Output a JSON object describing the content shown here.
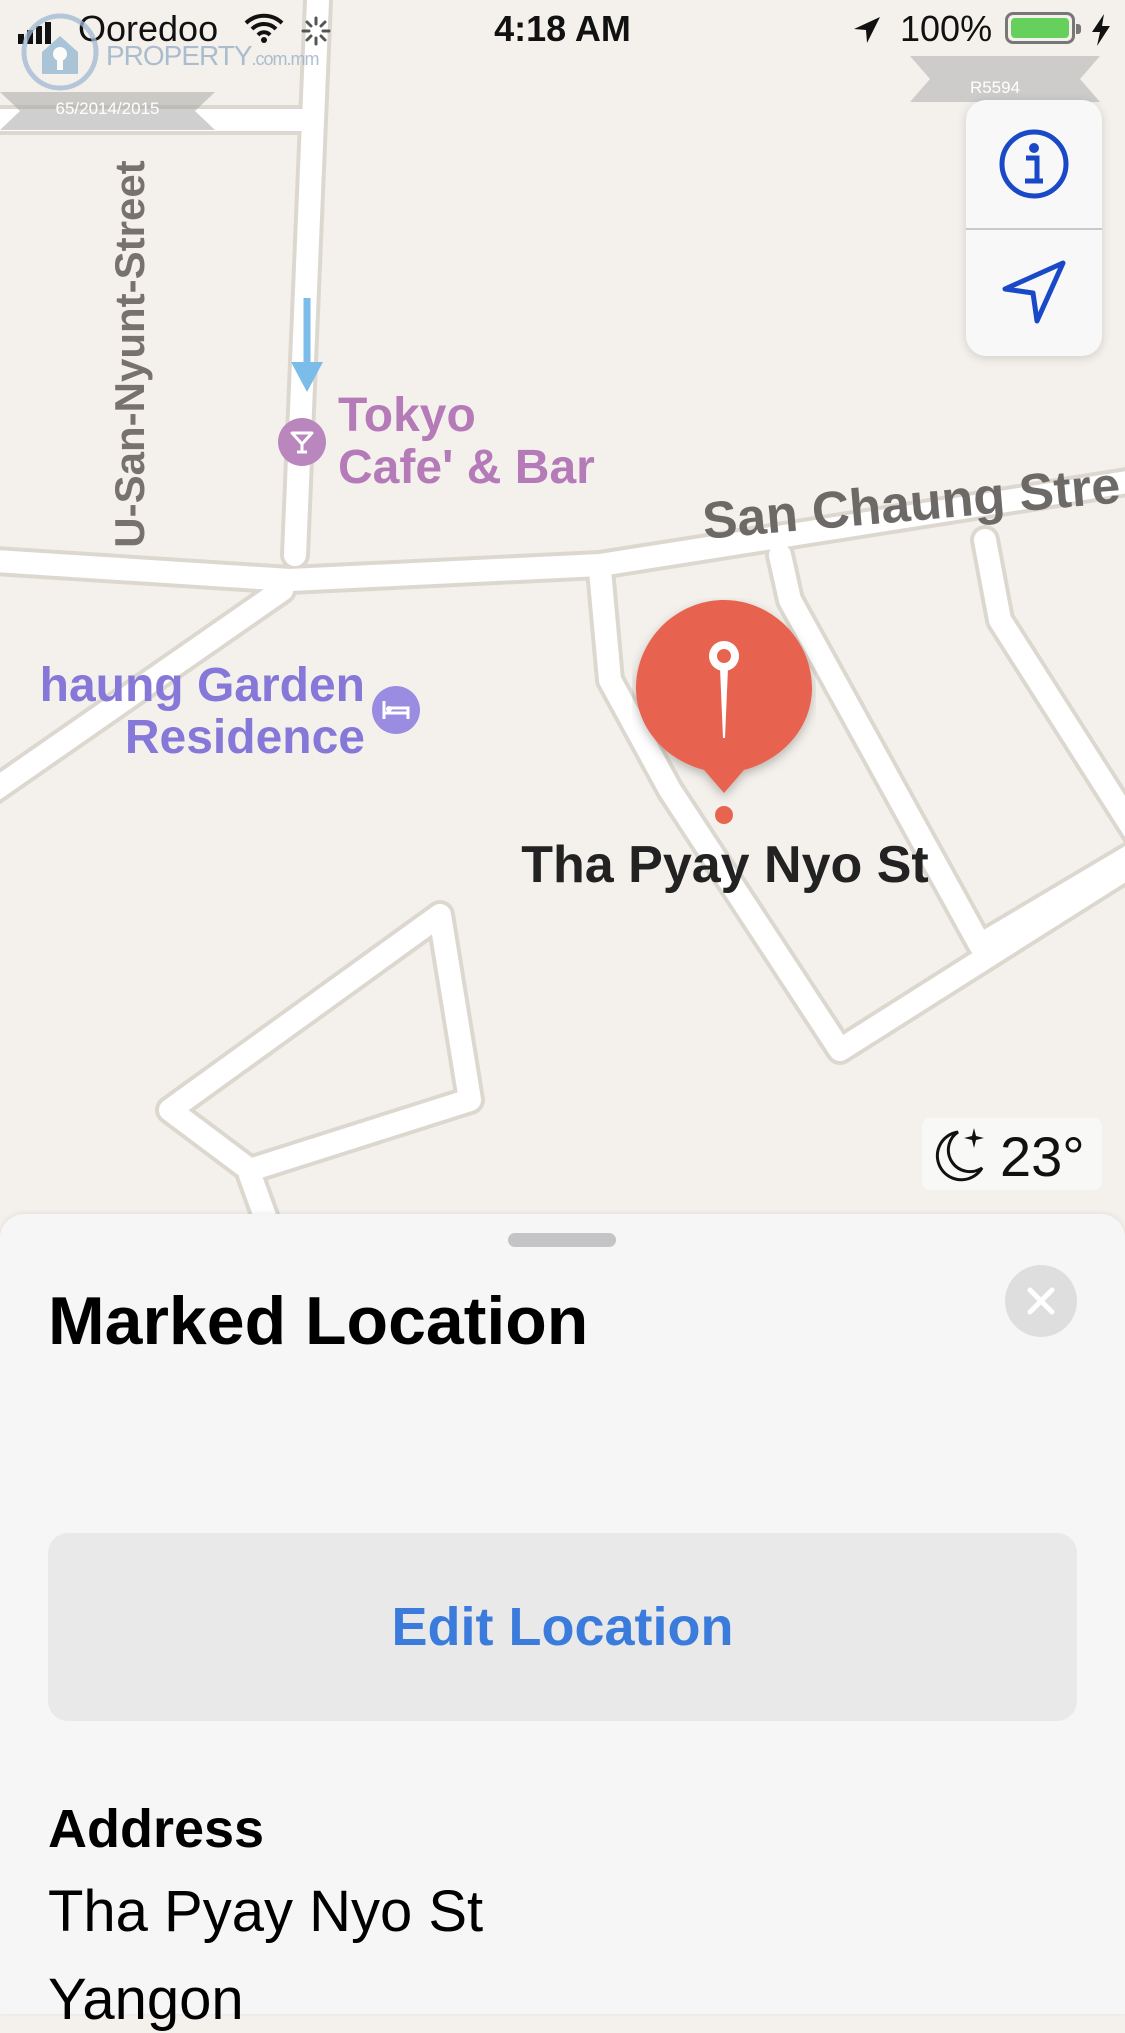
{
  "status_bar": {
    "carrier": "Ooredoo",
    "time": "4:18 AM",
    "battery_percent": "100%",
    "battery_level": 1.0
  },
  "watermark": {
    "brand": "PROPERTY",
    "domain": ".com.mm",
    "license": "65/2014/2015",
    "ref": "R5594"
  },
  "map": {
    "streets": {
      "vertical": "U-San-Nyunt-Street",
      "main": "San Chaung Stre"
    },
    "pois": {
      "bar": {
        "line1": "Tokyo",
        "line2": "Cafe' & Bar",
        "icon": "cocktail-icon",
        "color": "#b57ab8"
      },
      "hotel": {
        "line1": "haung Garden",
        "line2": "Residence",
        "icon": "bed-icon",
        "color": "#8678d8"
      }
    },
    "pin": {
      "label": "Tha Pyay Nyo St",
      "color": "#e8644f"
    },
    "weather": {
      "temperature": "23°",
      "icon": "moon-stars-icon"
    }
  },
  "map_controls": {
    "info_icon": "info-icon",
    "location_icon": "location-arrow-icon",
    "accent_color": "#1a49c7"
  },
  "sheet": {
    "title": "Marked Location",
    "edit_button": "Edit Location",
    "address_heading": "Address",
    "address_line1": "Tha Pyay Nyo St",
    "address_line2": "Yangon"
  }
}
